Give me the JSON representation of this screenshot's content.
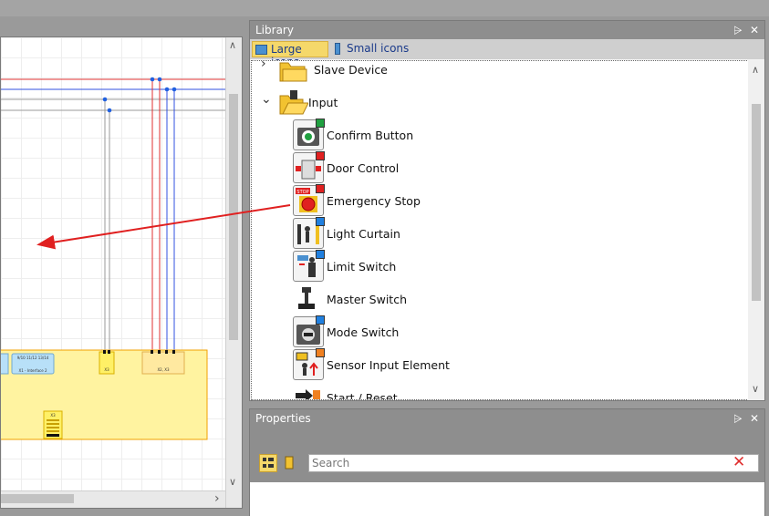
{
  "library": {
    "title": "Library",
    "pin_glyph": "⩥",
    "close_glyph": "✕",
    "view_modes": [
      {
        "label": "Large icons",
        "active": true
      },
      {
        "label": "Small icons",
        "active": false
      }
    ],
    "tree": [
      {
        "label": "Slave Device",
        "expander": "›",
        "type": "folder"
      },
      {
        "label": "Input",
        "expander": "⌄",
        "type": "folder-open"
      },
      {
        "label": "Confirm Button",
        "icon": "confirm-button-icon",
        "badge": "#20a040"
      },
      {
        "label": "Door Control",
        "icon": "door-control-icon",
        "badge": "#e02020"
      },
      {
        "label": "Emergency Stop",
        "icon": "emergency-stop-icon",
        "badge": "#e02020",
        "stop_text": "STOP"
      },
      {
        "label": "Light Curtain",
        "icon": "light-curtain-icon",
        "badge": "#2080e0"
      },
      {
        "label": "Limit Switch",
        "icon": "limit-switch-icon",
        "badge": "#2080e0"
      },
      {
        "label": "Master Switch",
        "icon": "master-switch-icon",
        "badge": ""
      },
      {
        "label": "Mode Switch",
        "icon": "mode-switch-icon",
        "badge": "#2080e0"
      },
      {
        "label": "Sensor Input Element",
        "icon": "sensor-input-icon",
        "badge": "#f08020"
      },
      {
        "label": "Start / Reset",
        "icon": "start-reset-icon",
        "badge": ""
      }
    ]
  },
  "properties": {
    "title": "Properties",
    "pin_glyph": "⩥",
    "close_glyph": "✕",
    "search_placeholder": "Search",
    "clear_glyph": "✕"
  },
  "canvas": {
    "scroll_up": "∧",
    "scroll_down": "∨",
    "scroll_right": "›",
    "module_labels": {
      "m1": "9/10 11/12 13/14",
      "m1b": "X1 - Interface 2",
      "m2": "X3",
      "m3": "X2, X3",
      "m4": "X3"
    }
  },
  "colors": {
    "panel_title": "#8e8e8e",
    "accent_active": "#f5d86a",
    "wire_red": "#e03030",
    "wire_blue": "#3050e0",
    "module_yellow": "#fff3a0",
    "module_border": "#f0a000"
  }
}
